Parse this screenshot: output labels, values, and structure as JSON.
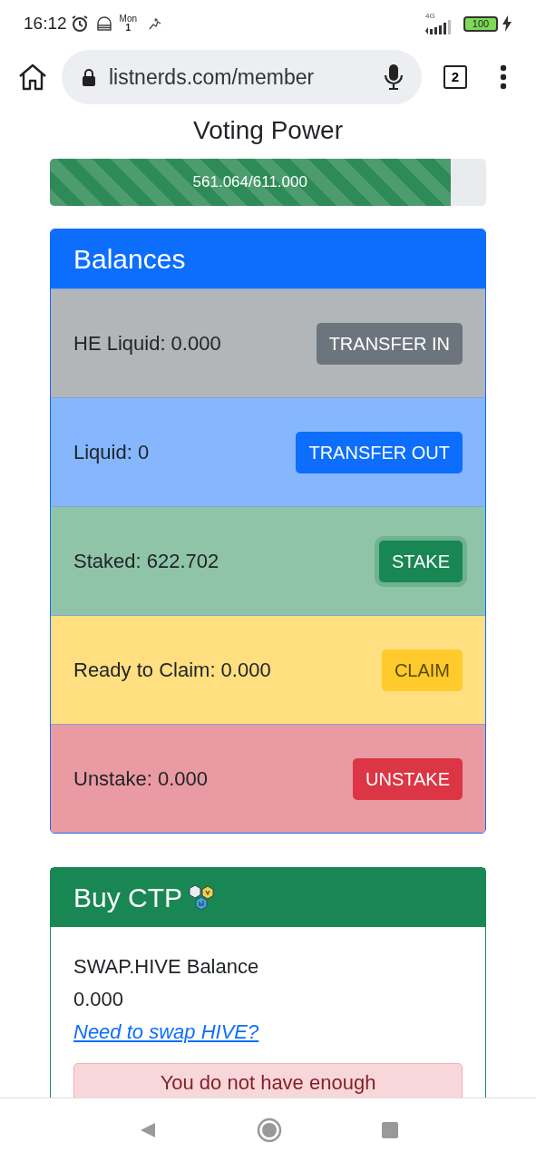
{
  "status_bar": {
    "time": "16:12",
    "day": "Mon",
    "date": "1",
    "network": "4G",
    "battery": "100"
  },
  "browser": {
    "url": "listnerds.com/member",
    "tab_count": "2"
  },
  "voting_power": {
    "title": "Voting Power",
    "reading": "561.064/611.000",
    "level": 0.918
  },
  "balances": {
    "title": "Balances",
    "rows": [
      {
        "kind": "secondary",
        "label": "HE Liquid: 0.000",
        "button": "TRANSFER IN",
        "focused": false
      },
      {
        "kind": "primary",
        "label": "Liquid: 0",
        "button": "TRANSFER OUT",
        "focused": false
      },
      {
        "kind": "success",
        "label": "Staked: 622.702",
        "button": "STAKE",
        "focused": true
      },
      {
        "kind": "warning",
        "label": "Ready to Claim: 0.000",
        "button": "CLAIM",
        "focused": false
      },
      {
        "kind": "danger",
        "label": "Unstake: 0.000",
        "button": "UNSTAKE",
        "focused": false
      }
    ]
  },
  "buy": {
    "title": "Buy CTP",
    "balance_label": "SWAP.HIVE Balance",
    "balance": "0.000",
    "link": "Need to swap HIVE?",
    "alert": "You do not have enough"
  }
}
